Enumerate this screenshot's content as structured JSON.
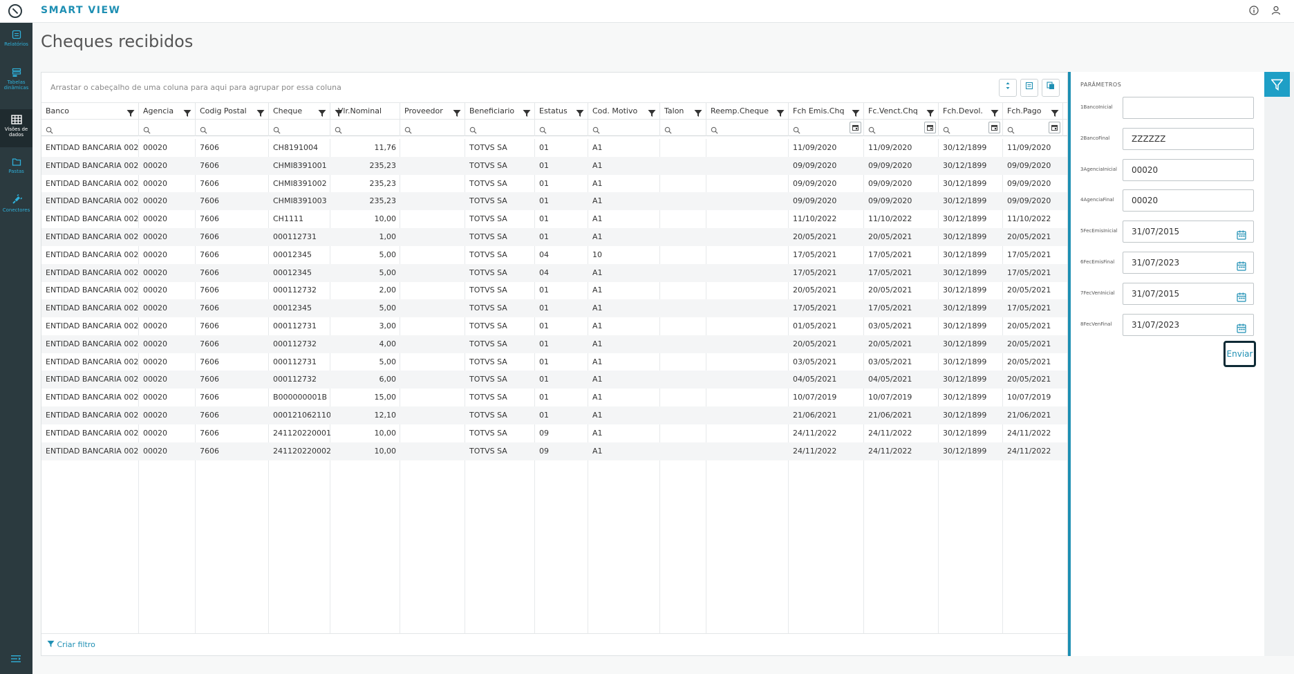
{
  "app": {
    "title": "SMART VIEW"
  },
  "topbar": {
    "info_icon": "info-icon",
    "user_icon": "user-icon"
  },
  "sidebar": {
    "items": [
      {
        "label": "Relatórios",
        "icon": "report-icon"
      },
      {
        "label": "Tabelas dinâmicas",
        "icon": "pivot-table-icon"
      },
      {
        "label": "Visões de dados",
        "icon": "grid-icon",
        "active": true
      },
      {
        "label": "Pastas",
        "icon": "folder-icon"
      },
      {
        "label": "Conectores",
        "icon": "plug-icon"
      }
    ],
    "collapse_icon": "collapse-menu-icon"
  },
  "page": {
    "title": "Cheques recibidos"
  },
  "grid": {
    "group_hint": "Arrastar o cabeçalho de uma coluna para aqui para agrupar por essa coluna",
    "columns": [
      "Banco",
      "Agencia",
      "Codig Postal",
      "Cheque",
      "Vlr.Nominal",
      "Proveedor",
      "Beneficiario",
      "Estatus",
      "Cod. Motivo",
      "Talon",
      "Reemp.Cheque",
      "Fch Emis.Chq",
      "Fc.Venct.Chq",
      "Fch.Devol.",
      "Fch.Pago"
    ],
    "rows": [
      [
        "ENTIDAD BANCARIA 002",
        "00020",
        "7606",
        "CH8191004",
        "11,76",
        "",
        "TOTVS SA",
        "01",
        "A1",
        "",
        "",
        "11/09/2020",
        "11/09/2020",
        "30/12/1899",
        "11/09/2020"
      ],
      [
        "ENTIDAD BANCARIA 002",
        "00020",
        "7606",
        "CHMI8391001",
        "235,23",
        "",
        "TOTVS SA",
        "01",
        "A1",
        "",
        "",
        "09/09/2020",
        "09/09/2020",
        "30/12/1899",
        "09/09/2020"
      ],
      [
        "ENTIDAD BANCARIA 002",
        "00020",
        "7606",
        "CHMI8391002",
        "235,23",
        "",
        "TOTVS SA",
        "01",
        "A1",
        "",
        "",
        "09/09/2020",
        "09/09/2020",
        "30/12/1899",
        "09/09/2020"
      ],
      [
        "ENTIDAD BANCARIA 002",
        "00020",
        "7606",
        "CHMI8391003",
        "235,23",
        "",
        "TOTVS SA",
        "01",
        "A1",
        "",
        "",
        "09/09/2020",
        "09/09/2020",
        "30/12/1899",
        "09/09/2020"
      ],
      [
        "ENTIDAD BANCARIA 002",
        "00020",
        "7606",
        "CH1111",
        "10,00",
        "",
        "TOTVS SA",
        "01",
        "A1",
        "",
        "",
        "11/10/2022",
        "11/10/2022",
        "30/12/1899",
        "11/10/2022"
      ],
      [
        "ENTIDAD BANCARIA 002",
        "00020",
        "7606",
        "000112731",
        "1,00",
        "",
        "TOTVS SA",
        "01",
        "A1",
        "",
        "",
        "20/05/2021",
        "20/05/2021",
        "30/12/1899",
        "20/05/2021"
      ],
      [
        "ENTIDAD BANCARIA 002",
        "00020",
        "7606",
        "00012345",
        "5,00",
        "",
        "TOTVS SA",
        "04",
        "10",
        "",
        "",
        "17/05/2021",
        "17/05/2021",
        "30/12/1899",
        "17/05/2021"
      ],
      [
        "ENTIDAD BANCARIA 002",
        "00020",
        "7606",
        "00012345",
        "5,00",
        "",
        "TOTVS SA",
        "04",
        "A1",
        "",
        "",
        "17/05/2021",
        "17/05/2021",
        "30/12/1899",
        "17/05/2021"
      ],
      [
        "ENTIDAD BANCARIA 002",
        "00020",
        "7606",
        "000112732",
        "2,00",
        "",
        "TOTVS SA",
        "01",
        "A1",
        "",
        "",
        "20/05/2021",
        "20/05/2021",
        "30/12/1899",
        "20/05/2021"
      ],
      [
        "ENTIDAD BANCARIA 002",
        "00020",
        "7606",
        "00012345",
        "5,00",
        "",
        "TOTVS SA",
        "01",
        "A1",
        "",
        "",
        "17/05/2021",
        "17/05/2021",
        "30/12/1899",
        "17/05/2021"
      ],
      [
        "ENTIDAD BANCARIA 002",
        "00020",
        "7606",
        "000112731",
        "3,00",
        "",
        "TOTVS SA",
        "01",
        "A1",
        "",
        "",
        "01/05/2021",
        "03/05/2021",
        "30/12/1899",
        "20/05/2021"
      ],
      [
        "ENTIDAD BANCARIA 002",
        "00020",
        "7606",
        "000112732",
        "4,00",
        "",
        "TOTVS SA",
        "01",
        "A1",
        "",
        "",
        "20/05/2021",
        "20/05/2021",
        "30/12/1899",
        "20/05/2021"
      ],
      [
        "ENTIDAD BANCARIA 002",
        "00020",
        "7606",
        "000112731",
        "5,00",
        "",
        "TOTVS SA",
        "01",
        "A1",
        "",
        "",
        "03/05/2021",
        "03/05/2021",
        "30/12/1899",
        "20/05/2021"
      ],
      [
        "ENTIDAD BANCARIA 002",
        "00020",
        "7606",
        "000112732",
        "6,00",
        "",
        "TOTVS SA",
        "01",
        "A1",
        "",
        "",
        "04/05/2021",
        "04/05/2021",
        "30/12/1899",
        "20/05/2021"
      ],
      [
        "ENTIDAD BANCARIA 002",
        "00020",
        "7606",
        "B000000001B",
        "15,00",
        "",
        "TOTVS SA",
        "01",
        "A1",
        "",
        "",
        "10/07/2019",
        "10/07/2019",
        "30/12/1899",
        "10/07/2019"
      ],
      [
        "ENTIDAD BANCARIA 002",
        "00020",
        "7606",
        "000121062110",
        "12,10",
        "",
        "TOTVS SA",
        "01",
        "A1",
        "",
        "",
        "21/06/2021",
        "21/06/2021",
        "30/12/1899",
        "21/06/2021"
      ],
      [
        "ENTIDAD BANCARIA 002",
        "00020",
        "7606",
        "241120220001",
        "10,00",
        "",
        "TOTVS SA",
        "09",
        "A1",
        "",
        "",
        "24/11/2022",
        "24/11/2022",
        "30/12/1899",
        "24/11/2022"
      ],
      [
        "ENTIDAD BANCARIA 002",
        "00020",
        "7606",
        "241120220002",
        "10,00",
        "",
        "TOTVS SA",
        "09",
        "A1",
        "",
        "",
        "24/11/2022",
        "24/11/2022",
        "30/12/1899",
        "24/11/2022"
      ]
    ],
    "footer_link": "Criar filtro"
  },
  "parameters": {
    "title": "PARÂMETROS",
    "fields": [
      {
        "label": "1BancoInicial",
        "value": "",
        "calendar": false
      },
      {
        "label": "2BancoFinal",
        "value": "ZZZZZZ",
        "calendar": false
      },
      {
        "label": "3AgenciaInicial",
        "value": "00020",
        "calendar": false
      },
      {
        "label": "4AgenciaFinal",
        "value": "00020",
        "calendar": false
      },
      {
        "label": "5FecEmisInicial",
        "value": "31/07/2015",
        "calendar": true
      },
      {
        "label": "6FecEmisFinal",
        "value": "31/07/2023",
        "calendar": true
      },
      {
        "label": "7FecVenInicial",
        "value": "31/07/2015",
        "calendar": true
      },
      {
        "label": "8FecVenFinal",
        "value": "31/07/2023",
        "calendar": true
      }
    ],
    "submit_label": "Enviar"
  },
  "colors": {
    "accent": "#1e8fb3",
    "sidebar_bg": "#2b3a3f"
  }
}
